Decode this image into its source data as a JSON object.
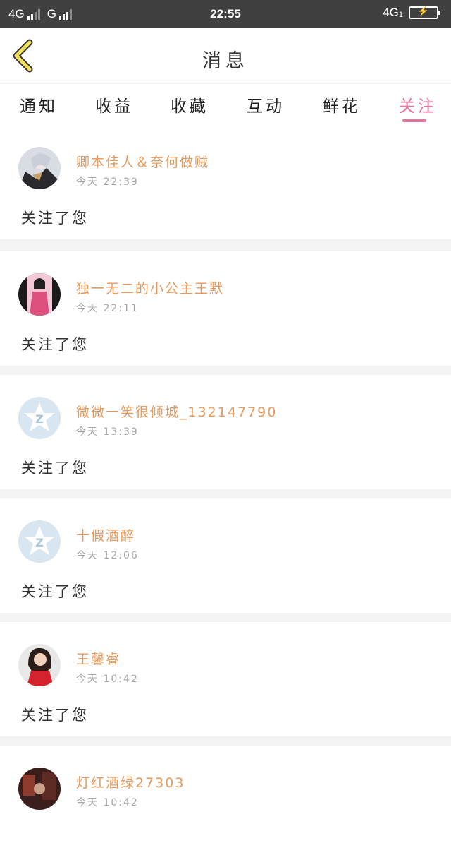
{
  "status_bar": {
    "net1": "4G",
    "net2": "G",
    "time": "22:55",
    "net3": "4G",
    "net3_sub": "1"
  },
  "header": {
    "title": "消息",
    "back_icon": "chevron-left-icon"
  },
  "tabs": [
    {
      "label": "通知",
      "active": false
    },
    {
      "label": "收益",
      "active": false
    },
    {
      "label": "收藏",
      "active": false
    },
    {
      "label": "互动",
      "active": false
    },
    {
      "label": "鲜花",
      "active": false
    },
    {
      "label": "关注",
      "active": true
    }
  ],
  "colors": {
    "accent": "#e7719f",
    "name": "#e89a5e"
  },
  "messages": [
    {
      "name": "卿本佳人＆奈何做贼",
      "time": "今天 22:39",
      "text": "关注了您",
      "avatar": "anime-avatar"
    },
    {
      "name": "独一无二的小公主王默",
      "time": "今天 22:11",
      "text": "关注了您",
      "avatar": "pink-girl-avatar"
    },
    {
      "name": "微微一笑很倾城_132147790",
      "time": "今天 13:39",
      "text": "关注了您",
      "avatar": "default-qq-avatar"
    },
    {
      "name": "十假酒醉",
      "time": "今天 12:06",
      "text": "关注了您",
      "avatar": "default-qq-avatar"
    },
    {
      "name": "王馨睿",
      "time": "今天 10:42",
      "text": "关注了您",
      "avatar": "red-dress-avatar"
    },
    {
      "name": "灯红酒绿27303",
      "time": "今天 10:42",
      "text": "",
      "avatar": "dark-photo-avatar"
    }
  ]
}
